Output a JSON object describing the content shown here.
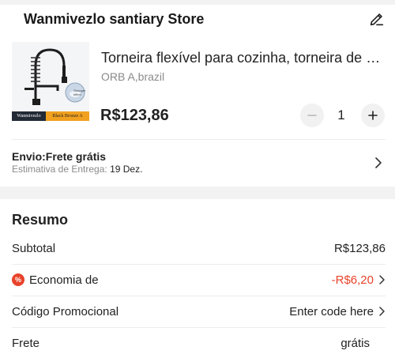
{
  "store": {
    "name": "Wanmivezlo santiary Store",
    "edit_icon": "pencil-icon"
  },
  "product": {
    "title": "Torneira flexível para cozinha, torneira de água quente e fria",
    "variant": "ORB A,brazil",
    "price": "R$123,86",
    "quantity": "1",
    "image": {
      "brand_label": "Wanmivezlo",
      "variant_label": "Black Bronze A",
      "small_text": "Stronger effect"
    }
  },
  "shipping": {
    "title": "Envio:Frete grátis",
    "estimate_label": "Estimativa de Entrega:",
    "estimate_date": "19 Dez."
  },
  "summary": {
    "title": "Resumo",
    "subtotal_label": "Subtotal",
    "subtotal_value": "R$123,86",
    "discount_label": "Economia de",
    "discount_value": "-R$6,20",
    "promo_label": "Código Promocional",
    "promo_value": "Enter code here",
    "shipping_label": "Frete",
    "shipping_value": "grátis"
  },
  "colors": {
    "accent": "#e8432a",
    "background": "#f2f2f2",
    "muted_text": "#8a8a8a"
  }
}
